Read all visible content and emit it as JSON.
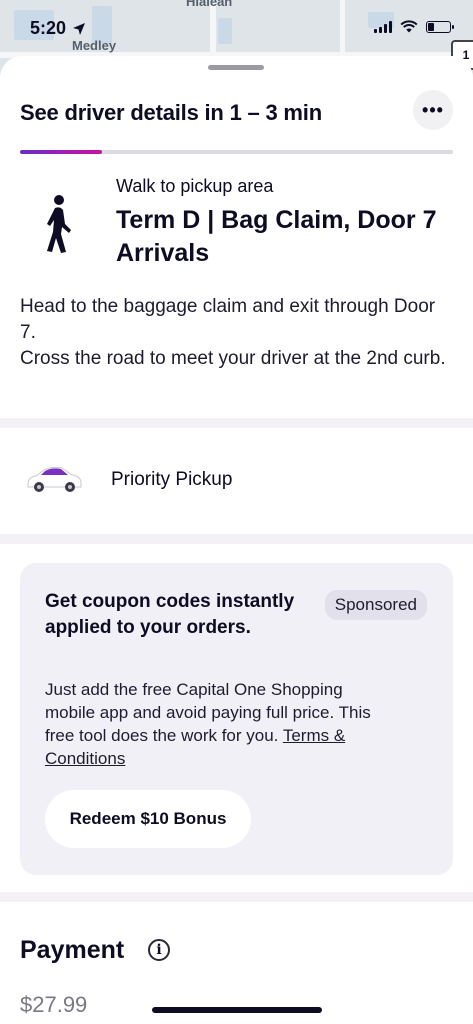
{
  "status_bar": {
    "time": "5:20",
    "location_icon": "location-arrow-icon",
    "signal_icon": "cellular-signal-icon",
    "wifi_icon": "wifi-icon",
    "battery_icon": "battery-low-icon"
  },
  "map": {
    "labels": [
      "Hialeah",
      "Medley"
    ],
    "route_badge": "1"
  },
  "header": {
    "title": "See driver details in 1 – 3 min",
    "more_button_icon": "more-dots-icon",
    "progress_fraction": 0.19
  },
  "pickup": {
    "walk_label": "Walk to pickup area",
    "name": "Term D | Bag Claim, Door 7 Arrivals",
    "instructions": [
      "Head to the baggage claim and exit through Door 7.",
      "Cross the road to meet your driver at the 2nd curb."
    ]
  },
  "ride": {
    "type_label": "Priority Pickup",
    "car_color": "#7b2fbf"
  },
  "ad": {
    "title": "Get coupon codes instantly applied to your orders.",
    "badge": "Sponsored",
    "body": "Just add the free Capital One Shopping mobile app and avoid paying full price. This free tool does the work for you.",
    "link": "Terms & Conditions",
    "button": "Redeem $10 Bonus"
  },
  "payment": {
    "title": "Payment",
    "price": "$27.99"
  },
  "colors": {
    "accent_start": "#6b2ec8",
    "accent_end": "#c8129e",
    "text": "#0d0c22",
    "card_bg": "#f1f0f6"
  }
}
